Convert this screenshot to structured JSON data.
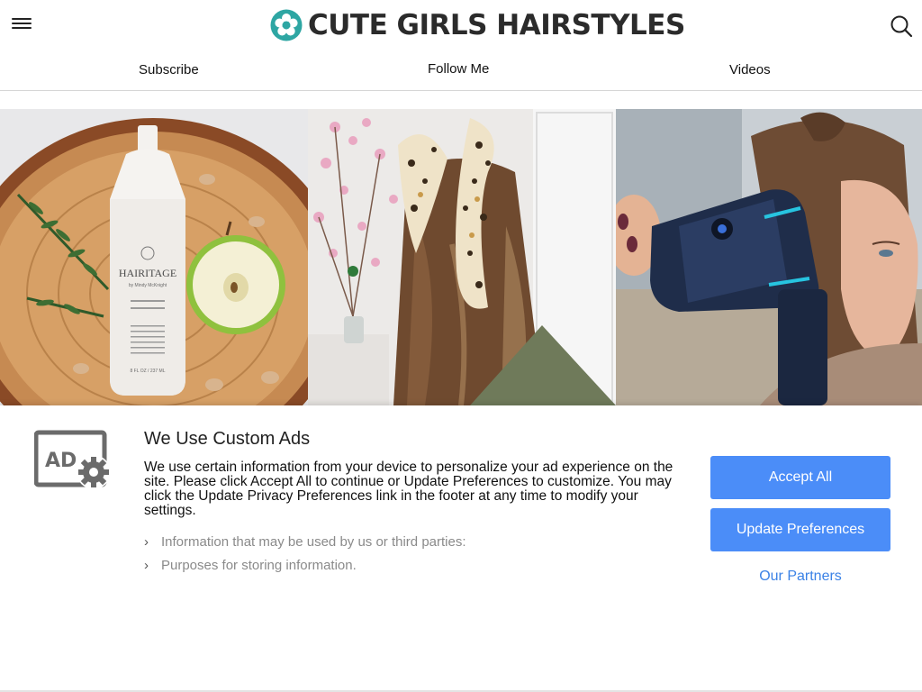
{
  "header": {
    "logo_text": "CUTE GIRLS HAIRSTYLES",
    "menu_icon": "hamburger-menu-icon",
    "search_icon": "search-icon",
    "logo_color": "#2ea6a3"
  },
  "subnav": {
    "subscribe": "Subscribe",
    "follow": "Follow Me",
    "videos": "Videos"
  },
  "tiles": [
    {
      "name": "hair-rinse-product-photo",
      "bottle_brand": "HAIRITAGE",
      "bottle_sub": "by Mindy McKnight",
      "bottle_size": "8 FL OZ / 237 ML"
    },
    {
      "name": "leopard-scarf-hairstyle-photo"
    },
    {
      "name": "hair-dryer-styling-photo"
    }
  ],
  "consent": {
    "title": "We Use Custom Ads",
    "body": "We use certain information from your device to personalize your ad experience on the site. Please click Accept All to continue or Update Preferences to customize. You may click the Update Privacy Preferences link in the footer at any time to modify your settings.",
    "items": [
      "Information that may be used by us or third parties:",
      "Purposes for storing information."
    ],
    "accept_label": "Accept All",
    "update_label": "Update Preferences",
    "partners_label": "Our Partners",
    "button_color": "#4b8df8",
    "link_color": "#3b82e6",
    "ad_icon_label": "AD"
  }
}
